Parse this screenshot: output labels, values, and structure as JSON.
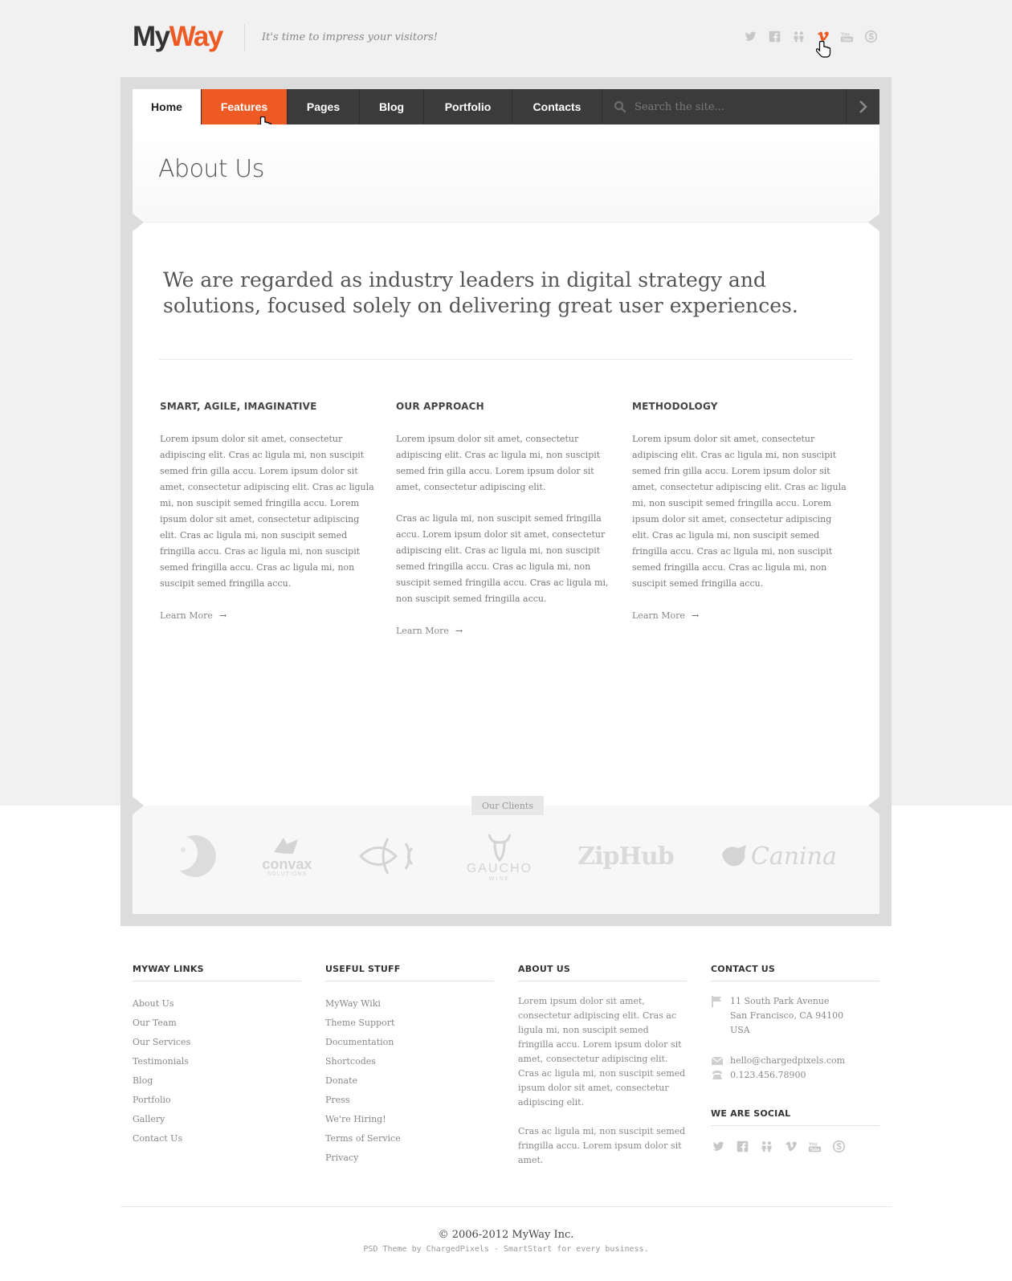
{
  "header": {
    "logo_part1": "My",
    "logo_part2": "Way",
    "tagline": "It's time to impress your visitors!",
    "social": [
      "twitter-icon",
      "facebook-icon",
      "people-icon",
      "vimeo-icon",
      "youtube-icon",
      "skype-icon"
    ],
    "active_social": "vimeo-icon"
  },
  "nav": {
    "items": [
      "Home",
      "Features",
      "Pages",
      "Blog",
      "Portfolio",
      "Contacts"
    ],
    "active": "Home",
    "highlighted": "Features",
    "search_placeholder": "Search the site..."
  },
  "page": {
    "title": "About Us",
    "lead": "We are regarded as industry leaders in digital strategy and solutions, focused solely on delivering great user experiences."
  },
  "columns": [
    {
      "heading": "SMART, AGILE, IMAGINATIVE",
      "paragraphs": [
        "Lorem ipsum dolor sit amet, consectetur adipiscing elit. Cras ac ligula mi, non suscipit semed frin gilla accu. Lorem ipsum dolor sit amet, consectetur adipiscing elit. Cras ac ligula mi, non suscipit semed fringilla accu. Lorem ipsum dolor sit amet, consectetur adipiscing elit. Cras ac ligula mi, non suscipit semed fringilla accu. Cras ac ligula mi, non suscipit semed fringilla accu. Cras ac ligula mi, non suscipit semed fringilla accu."
      ],
      "link": "Learn More"
    },
    {
      "heading": "OUR APPROACH",
      "paragraphs": [
        "Lorem ipsum dolor sit amet, consectetur adipiscing elit. Cras ac ligula mi, non suscipit semed frin gilla accu. Lorem ipsum dolor sit amet, consectetur adipiscing elit.",
        "Cras ac ligula mi, non suscipit semed fringilla accu. Lorem ipsum dolor sit amet, consectetur adipiscing elit. Cras ac ligula mi, non suscipit semed fringilla accu. Cras ac ligula mi, non suscipit semed fringilla accu. Cras ac ligula mi, non suscipit semed fringilla accu."
      ],
      "link": "Learn More"
    },
    {
      "heading": "METHODOLOGY",
      "paragraphs": [
        "Lorem ipsum dolor sit amet, consectetur adipiscing elit. Cras ac ligula mi, non suscipit semed frin gilla accu. Lorem ipsum dolor sit amet, consectetur adipiscing elit. Cras ac ligula mi, non suscipit semed fringilla accu. Lorem ipsum dolor sit amet, consectetur adipiscing elit. Cras ac ligula mi, non suscipit semed fringilla accu. Cras ac ligula mi, non suscipit semed fringilla accu. Cras ac ligula mi, non suscipit semed fringilla accu."
      ],
      "link": "Learn More"
    }
  ],
  "clients": {
    "label": "Our Clients",
    "convax_name": "convax",
    "convax_sub": "SOLUTIONS",
    "gaucho_name": "GAUCHO",
    "gaucho_sub": "WINE",
    "ziphub": "ZipHub",
    "canina": "Canina"
  },
  "footer": {
    "links_heading": "MYWAY LINKS",
    "links": [
      "About Us",
      "Our Team",
      "Our Services",
      "Testimonials",
      "Blog",
      "Portfolio",
      "Gallery",
      "Contact Us"
    ],
    "useful_heading": "USEFUL STUFF",
    "useful": [
      "MyWay Wiki",
      "Theme Support",
      "Documentation",
      "Shortcodes",
      "Donate",
      "Press",
      "We're Hiring!",
      "Terms of Service",
      "Privacy"
    ],
    "about_heading": "ABOUT US",
    "about_p1": "Lorem ipsum dolor sit amet, consectetur adipiscing elit. Cras ac ligula mi, non suscipit semed fringilla accu. Lorem ipsum dolor sit amet, consectetur adipiscing elit. Cras ac ligula mi, non suscipit semed ipsum dolor sit amet, consectetur adipiscing elit.",
    "about_p2": "Cras ac ligula mi, non suscipit semed fringilla accu. Lorem ipsum dolor sit amet.",
    "contact_heading": "CONTACT US",
    "address_line1": "11 South Park Avenue",
    "address_line2": "San Francisco, CA 94100",
    "address_line3": "USA",
    "email": "hello@chargedpixels.com",
    "phone": "0.123.456.78900",
    "social_heading": "WE ARE SOCIAL",
    "copyright": "© 2006-2012 MyWay Inc.",
    "credit": "PSD Theme by ChargedPixels - SmartStart for every business."
  },
  "colors": {
    "accent": "#ee5a24",
    "nav_bg": "#3b3b3b",
    "frame": "#dcdcdc"
  }
}
